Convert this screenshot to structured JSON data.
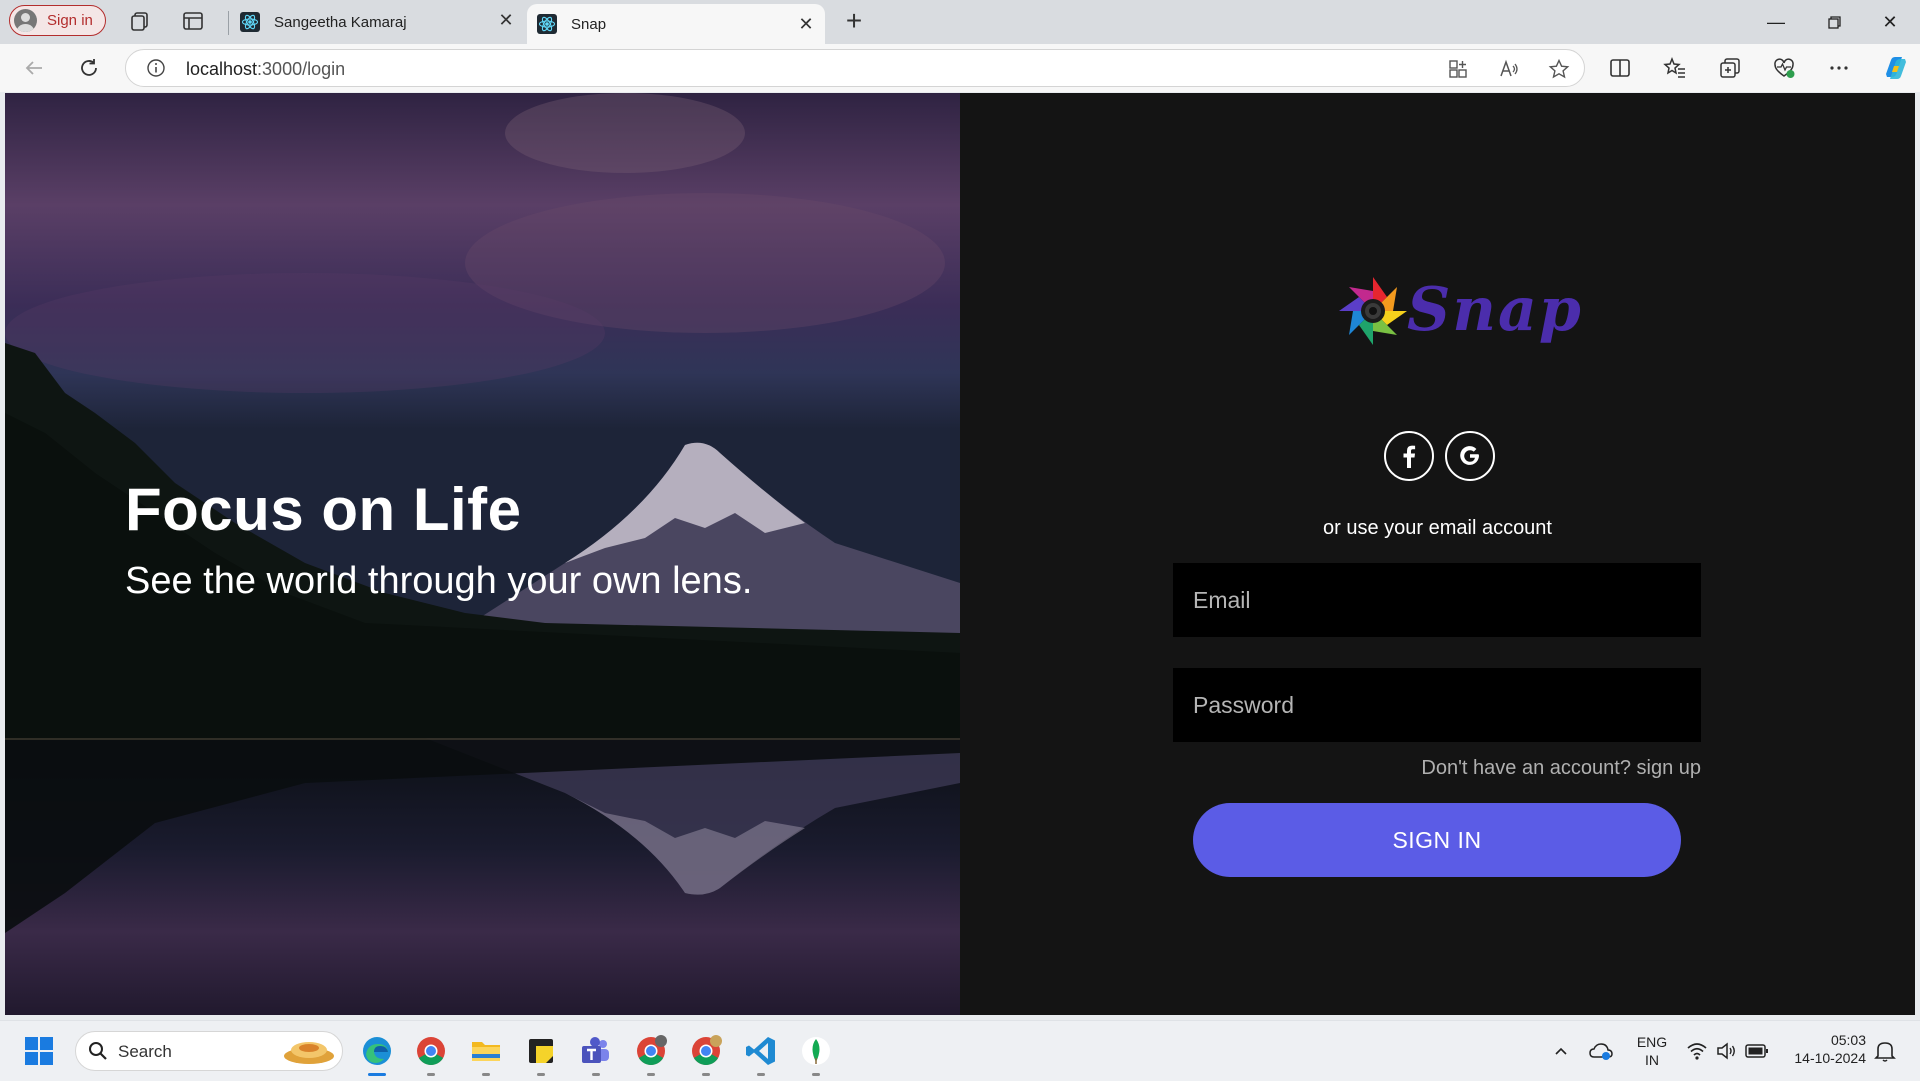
{
  "browser": {
    "profile_label": "Sign in",
    "tabs": [
      {
        "title": "Sangeetha Kamaraj",
        "active": false
      },
      {
        "title": "Snap",
        "active": true
      }
    ],
    "url_host": "localhost",
    "url_path": ":3000/login"
  },
  "hero": {
    "title": "Focus on Life",
    "subtitle": "See the world through your own lens."
  },
  "login": {
    "logo_text": "Snap",
    "social": [
      "f",
      "G"
    ],
    "alt_text": "or use your email account",
    "email_placeholder": "Email",
    "password_placeholder": "Password",
    "signup_text": "Don't have an account? sign up",
    "submit_label": "SIGN IN"
  },
  "taskbar": {
    "search_label": "Search",
    "lang_line1": "ENG",
    "lang_line2": "IN",
    "time": "05:03",
    "date": "14-10-2024"
  },
  "colors": {
    "accent": "#5b5ce6",
    "logo": "#4b2dac",
    "panel_bg": "#141414"
  }
}
